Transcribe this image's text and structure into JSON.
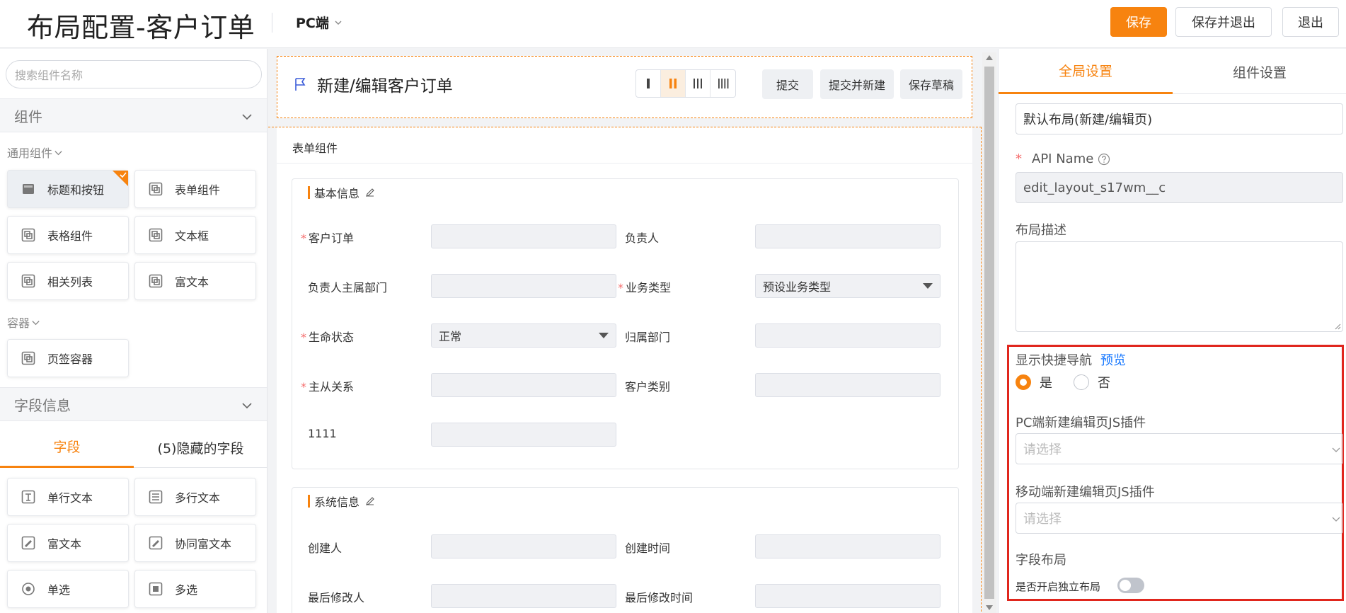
{
  "header": {
    "title": "布局配置-客户订单",
    "platform": "PC端",
    "save": "保存",
    "save_exit": "保存并退出",
    "exit": "退出"
  },
  "left": {
    "search_placeholder": "搜索组件名称",
    "components_section": "组件",
    "general_group": "通用组件",
    "general": [
      "标题和按钮",
      "表单组件",
      "表格组件",
      "文本框",
      "相关列表",
      "富文本"
    ],
    "container_group": "容器",
    "containers": [
      "页签容器"
    ],
    "fields_section": "字段信息",
    "field_tabs": [
      "字段",
      "(5)隐藏的字段"
    ],
    "fields": [
      "单行文本",
      "多行文本",
      "富文本",
      "协同富文本",
      "单选",
      "多选"
    ]
  },
  "canvas": {
    "form_title": "新建/编辑客户订单",
    "column_options": [
      "1",
      "2",
      "3",
      "4"
    ],
    "buttons": [
      "提交",
      "提交并新建",
      "保存草稿"
    ],
    "form_component_label": "表单组件",
    "basic_section": "基本信息",
    "system_section": "系统信息",
    "basic_fields": {
      "customer_order": "客户订单",
      "owner": "负责人",
      "owner_dept": "负责人主属部门",
      "biz_type": "业务类型",
      "biz_type_value": "预设业务类型",
      "life_status": "生命状态",
      "life_status_value": "正常",
      "belong_dept": "归属部门",
      "master_detail": "主从关系",
      "customer_category": "客户类别",
      "custom_1111": "1111"
    },
    "system_fields": {
      "creator": "创建人",
      "create_time": "创建时间",
      "last_modifier": "最后修改人",
      "last_modified_time": "最后修改时间"
    }
  },
  "right": {
    "tabs": [
      "全局设置",
      "组件设置"
    ],
    "layout_name_value": "默认布局(新建/编辑页)",
    "api_name_label": "API Name",
    "api_name_value": "edit_layout_s17wm__c",
    "desc_label": "布局描述",
    "quick_nav_label": "显示快捷导航",
    "preview_link": "预览",
    "yes": "是",
    "no": "否",
    "pc_js_label": "PC端新建编辑页JS插件",
    "mobile_js_label": "移动端新建编辑页JS插件",
    "select_placeholder": "请选择",
    "field_layout_label": "字段布局",
    "independent_layout_label": "是否开启独立布局",
    "independent_layout_on": false,
    "quick_nav_selected": "是"
  },
  "colors": {
    "accent": "#f7830f",
    "highlight_box": "#e0261d",
    "link": "#1677ff",
    "required": "#f56c6c"
  }
}
